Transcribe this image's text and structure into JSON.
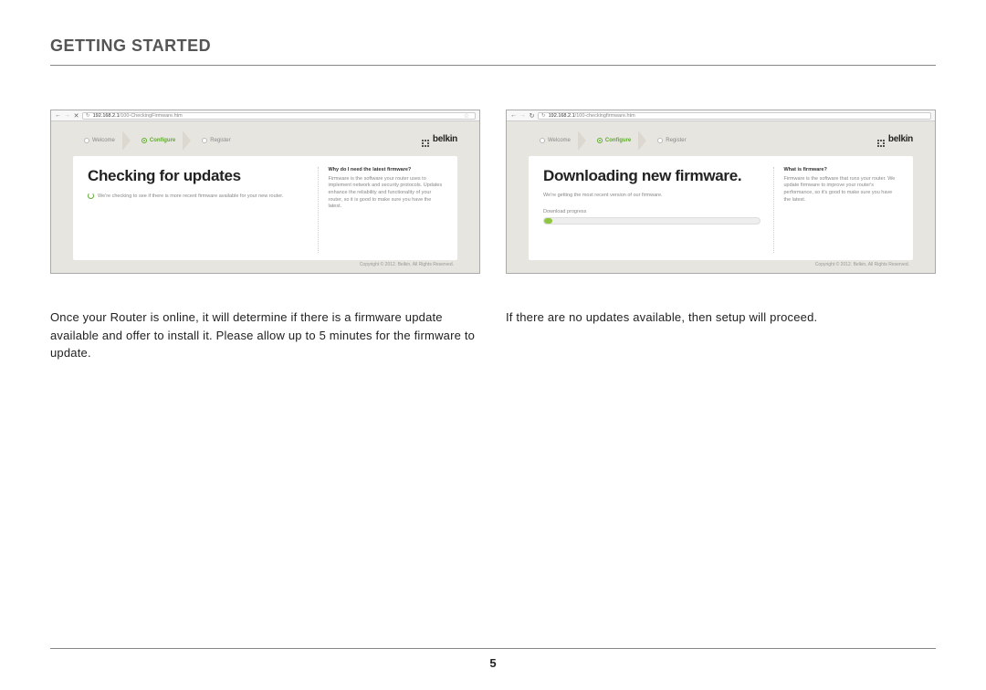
{
  "header": {
    "title": "GETTING STARTED"
  },
  "page_number": "5",
  "brand": "belkin",
  "tabs": {
    "welcome": "Welcome",
    "configure": "Configure",
    "register": "Register"
  },
  "left": {
    "url_host": "192.168.2.1",
    "url_path": "/100-CheckingFirmware.htm",
    "heading": "Checking for updates",
    "subtext": "We're checking to see if there is more recent firmware available for your new router.",
    "sidebar_heading": "Why do I need the latest firmware?",
    "sidebar_body": "Firmware is the software your router uses to implement network and security protocols. Updates enhance the reliability and functionality of your router, so it is good to make sure you have the latest.",
    "copyright": "Copyright © 2012. Belkin, All Rights Reserved.",
    "caption": "Once your Router is online, it will determine if there is a firmware update available and offer to install it. Please allow up to 5 minutes for the firmware to update."
  },
  "right": {
    "url_host": "192.168.2.1",
    "url_path": "/100-checkingfirmware.htm",
    "heading": "Downloading new firmware.",
    "subtext": "We're getting the most recent version of our firmware.",
    "progress_label": "Download progress",
    "sidebar_heading": "What is firmware?",
    "sidebar_body": "Firmware is the software that runs your router. We update firmware to improve your router's performance, so it's good to make sure you have the latest.",
    "copyright": "Copyright © 2012. Belkin, All Rights Reserved.",
    "caption": "If there are no updates available, then setup will proceed."
  }
}
